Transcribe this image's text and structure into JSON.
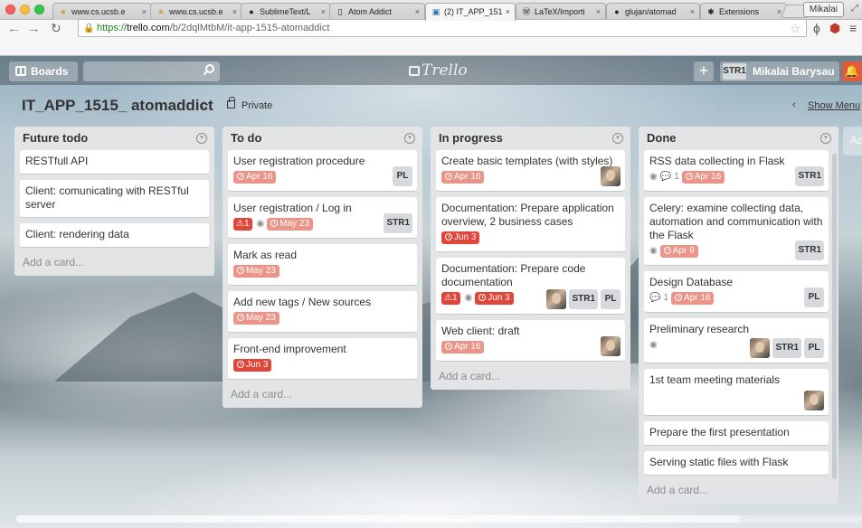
{
  "browser": {
    "tabs": [
      {
        "label": "www.cs.ucsb.e",
        "icon": "ucsb-icon",
        "active": false
      },
      {
        "label": "www.cs.ucsb.e",
        "icon": "ucsb-icon",
        "active": false
      },
      {
        "label": "SublimeText/L",
        "icon": "github-icon",
        "active": false
      },
      {
        "label": "Atom Addict",
        "icon": "page-icon",
        "active": false
      },
      {
        "label": "(2) IT_APP_151",
        "icon": "trello-icon",
        "active": true
      },
      {
        "label": "LaTeX/Importi",
        "icon": "wiki-icon",
        "active": false
      },
      {
        "label": "glujan/atomad",
        "icon": "github-icon",
        "active": false
      },
      {
        "label": "Extensions",
        "icon": "puzzle-icon",
        "active": false
      }
    ],
    "profile": "Mikalai",
    "url_scheme": "https://",
    "url_host": "trello.com",
    "url_path": "/b/2dqlMtbM/it-app-1515-atomaddict",
    "extension_badge": "2"
  },
  "appbar": {
    "boards_label": "Boards",
    "search_placeholder": "",
    "logo_text": "Trello",
    "plus_label": "+",
    "user_initials": "STR1",
    "user_name": "Mikalai Barysau"
  },
  "board": {
    "title": "IT_APP_1515_ atomaddict",
    "privacy": "Private",
    "show_menu": "Show Menu",
    "add_list_label": "Add a list..."
  },
  "lists": [
    {
      "title": "Future todo",
      "add_card": "Add a card...",
      "cards": [
        {
          "title": "RESTfull API"
        },
        {
          "title": "Client: comunicating with RESTful server"
        },
        {
          "title": "Client: rendering data"
        }
      ]
    },
    {
      "title": "To do",
      "add_card": "Add a card...",
      "cards": [
        {
          "title": "User registration procedure",
          "due": "Apr 16",
          "members": [
            "PL"
          ]
        },
        {
          "title": "User registration / Log in",
          "alert": "1",
          "watch": true,
          "due": "May 23",
          "members": [
            "STR1"
          ]
        },
        {
          "title": "Mark as read",
          "due": "May 23"
        },
        {
          "title": "Add new tags / New sources",
          "due": "May 23"
        },
        {
          "title": "Front-end improvement",
          "due": "Jun 3",
          "due_style": "red"
        }
      ]
    },
    {
      "title": "In progress",
      "add_card": "Add a card...",
      "cards": [
        {
          "title": "Create basic templates (with styles)",
          "due": "Apr 16",
          "photo": true
        },
        {
          "title": "Documentation: Prepare application overview, 2 business cases",
          "due": "Jun 3",
          "due_style": "red"
        },
        {
          "title": "Documentation: Prepare code documentation",
          "alert": "1",
          "watch": true,
          "due": "Jun 3",
          "due_style": "red",
          "photo": true,
          "members": [
            "STR1",
            "PL"
          ]
        },
        {
          "title": "Web client: draft",
          "due": "Apr 16",
          "photo": true
        }
      ]
    },
    {
      "title": "Done",
      "add_card": "Add a card...",
      "cards": [
        {
          "title": "RSS data collecting in Flask",
          "watch": true,
          "comments": "1",
          "due": "Apr 16",
          "members": [
            "STR1"
          ]
        },
        {
          "title": "Celery: examine collecting data, automation and communication with the Flask",
          "watch": true,
          "due": "Apr 9",
          "members": [
            "STR1"
          ]
        },
        {
          "title": "Design Database",
          "comments": "1",
          "due": "Apr 16",
          "members": [
            "PL"
          ]
        },
        {
          "title": "Preliminary research",
          "watch": true,
          "photo": true,
          "members": [
            "STR1",
            "PL"
          ]
        },
        {
          "title": "1st team meeting materials",
          "photo": true
        },
        {
          "title": "Prepare the first presentation"
        },
        {
          "title": "Serving static files with Flask"
        }
      ]
    }
  ],
  "icons": {
    "clock": "clock-icon",
    "watch": "eye-icon",
    "comment": "comment-icon",
    "alert": "bell-icon"
  },
  "colors": {
    "due_overdue": "#ec9488",
    "due_red": "#e0463a",
    "list_bg": "#e2e4e6",
    "notif": "#e05b3d"
  }
}
